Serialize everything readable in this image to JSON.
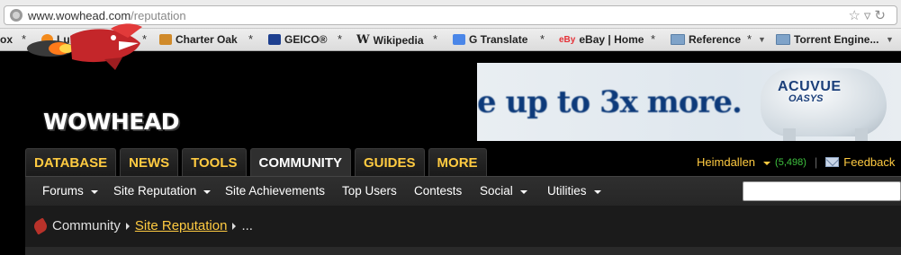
{
  "browser": {
    "url_host": "www.wowhead.com",
    "url_path": "/reputation",
    "bookmarks": [
      {
        "label": "ox",
        "icon": "page-icon"
      },
      {
        "label": "Lumosity.com",
        "icon": "lumosity-icon"
      },
      {
        "label": "Charter Oak",
        "icon": "charter-oak-icon"
      },
      {
        "label": "GEICO®",
        "icon": "geico-icon"
      },
      {
        "label": "Wikipedia",
        "icon": "wikipedia-icon"
      },
      {
        "label": "G Translate",
        "icon": "translate-icon"
      },
      {
        "label": "eBay | Home",
        "icon": "ebay-icon"
      },
      {
        "label": "Reference",
        "icon": "folder-icon"
      },
      {
        "label": "Torrent Engine...",
        "icon": "folder-icon"
      }
    ],
    "separator": "*"
  },
  "site": {
    "logo_text": "WOWHEAD",
    "ad": {
      "headline": "e up to 3x more.",
      "brand": "ACUVUE",
      "brand_sub": "OASYS"
    },
    "tabs": [
      {
        "label": "DATABASE",
        "active": false
      },
      {
        "label": "NEWS",
        "active": false
      },
      {
        "label": "TOOLS",
        "active": false
      },
      {
        "label": "COMMUNITY",
        "active": true
      },
      {
        "label": "GUIDES",
        "active": false
      },
      {
        "label": "MORE",
        "active": false
      }
    ],
    "user": {
      "name": "Heimdallen",
      "count": "(5,498)",
      "separator": "|",
      "feedback": "Feedback"
    },
    "subnav": [
      {
        "label": "Forums",
        "dropdown": true
      },
      {
        "label": "Site Reputation",
        "dropdown": true
      },
      {
        "label": "Site Achievements",
        "dropdown": false
      },
      {
        "label": "Top Users",
        "dropdown": false
      },
      {
        "label": "Contests",
        "dropdown": false
      },
      {
        "label": "Social",
        "dropdown": true
      },
      {
        "label": "Utilities",
        "dropdown": true
      }
    ],
    "breadcrumb": {
      "root": "Community",
      "current": "Site Reputation",
      "more": "..."
    }
  },
  "colors": {
    "accent": "#ffcb41",
    "count_green": "#3fc33f",
    "background": "#000000"
  }
}
